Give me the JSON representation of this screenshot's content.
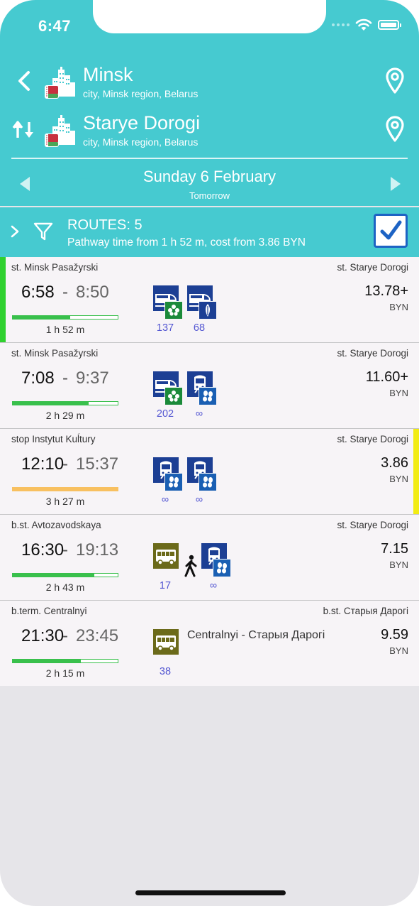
{
  "status_bar": {
    "time": "6:47"
  },
  "colors": {
    "header_bg": "#46cad0",
    "train_blue": "#1c3f94",
    "bus_olive": "#6b6a1a",
    "badge_green": "#1b8a3a",
    "badge_blue": "#1a5fb3",
    "accent_green": "#2fd12f",
    "accent_yellow": "#f2ec14",
    "route_label": "#5457d2",
    "checkbox_blue": "#1d63c4"
  },
  "from": {
    "name": "Minsk",
    "subtitle": "city, Minsk region, Belarus"
  },
  "to": {
    "name": "Starye Dorogi",
    "subtitle": "city, Minsk region, Belarus"
  },
  "date": {
    "title": "Sunday 6 February",
    "subtitle": "Tomorrow"
  },
  "routes_summary": {
    "title": "ROUTES: 5",
    "subtitle": "Pathway time from 1 h 52 m, cost from 3.86 BYN",
    "checked": true
  },
  "routes": [
    {
      "from_stop": "st. Minsk Pasažyrski",
      "to_stop": "st. Starye Dorogi",
      "depart": "6:58",
      "arrive": "8:50",
      "dash": "-",
      "duration": "1 h 52 m",
      "price": "13.78+",
      "currency": "BYN",
      "progress": 0.55,
      "bar_color": "green",
      "accent": "left-green",
      "legs": [
        {
          "icon": "train-icon",
          "badge": "green-flower-badge-icon",
          "label": "137"
        },
        {
          "icon": "train-icon",
          "badge": "blue-leaf-badge-icon",
          "label": "68"
        }
      ]
    },
    {
      "from_stop": "st. Minsk Pasažyrski",
      "to_stop": "st. Starye Dorogi",
      "depart": "7:08",
      "arrive": "9:37",
      "dash": "-",
      "duration": "2 h 29 m",
      "price": "11.60+",
      "currency": "BYN",
      "progress": 0.72,
      "bar_color": "green",
      "accent": "none",
      "legs": [
        {
          "icon": "train-icon",
          "badge": "green-flower-badge-icon",
          "label": "202"
        },
        {
          "icon": "tram-train-icon",
          "badge": "blue-flower-badge-icon",
          "label": "∞"
        }
      ]
    },
    {
      "from_stop": "stop Instytut Kuĺtury",
      "to_stop": "st. Starye Dorogi",
      "depart": "12:10",
      "arrive": "15:37",
      "dash": "-",
      "duration": "3 h 27 m",
      "price": "3.86",
      "currency": "BYN",
      "progress": 1.0,
      "bar_color": "orange",
      "accent": "right-yellow",
      "legs": [
        {
          "icon": "tram-train-icon",
          "badge": "blue-flower-badge-icon",
          "label": "∞"
        },
        {
          "icon": "tram-train-icon",
          "badge": "blue-flower-badge-icon",
          "label": "∞"
        }
      ]
    },
    {
      "from_stop": "b.st. Avtozavodskaya",
      "to_stop": "st. Starye Dorogi",
      "depart": "16:30",
      "arrive": "19:13",
      "dash": "-",
      "duration": "2 h 43 m",
      "price": "7.15",
      "currency": "BYN",
      "progress": 0.78,
      "bar_color": "green",
      "accent": "none",
      "walk": true,
      "legs": [
        {
          "icon": "bus-icon",
          "badge": "",
          "label": "17"
        },
        {
          "icon": "tram-train-icon",
          "badge": "blue-flower-badge-icon",
          "label": "∞"
        }
      ]
    },
    {
      "from_stop": "b.term. Centralnyi",
      "to_stop": "b.st. Старыя Дарогі",
      "depart": "21:30",
      "arrive": "23:45",
      "dash": "-",
      "duration": "2 h 15 m",
      "price": "9.59",
      "currency": "BYN",
      "progress": 0.65,
      "bar_color": "green",
      "accent": "none",
      "route_name": "Centralnyi - Старыя Дарогі",
      "legs": [
        {
          "icon": "bus-icon",
          "badge": "",
          "label": "38"
        }
      ]
    }
  ]
}
